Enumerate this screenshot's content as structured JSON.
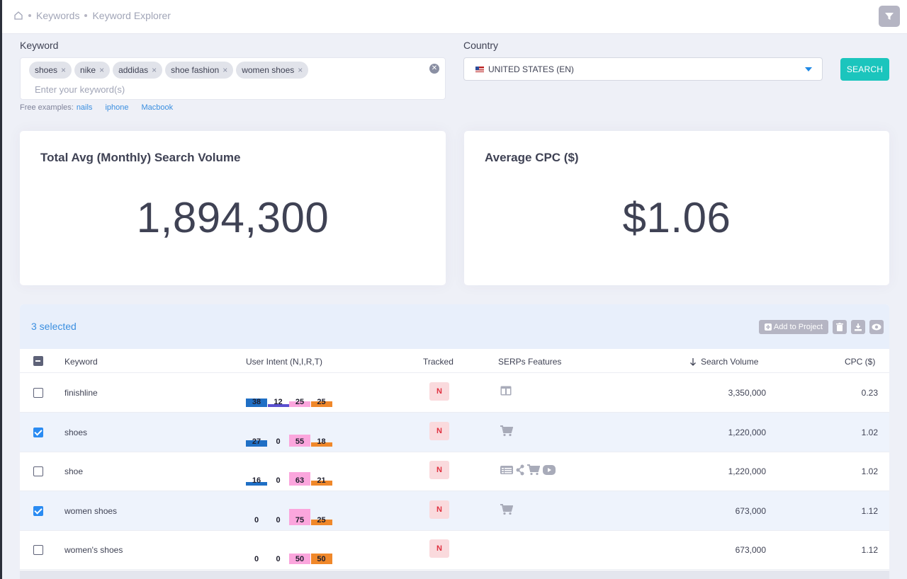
{
  "breadcrumb": {
    "items": [
      "Keywords",
      "Keyword Explorer"
    ]
  },
  "form": {
    "keyword_label": "Keyword",
    "country_label": "Country",
    "tags": [
      "shoes",
      "nike",
      "addidas",
      "shoe fashion",
      "women shoes"
    ],
    "tag_remove": "×",
    "keyword_placeholder": "Enter your keyword(s)",
    "examples_prefix": "Free examples:",
    "examples": [
      "nails",
      "iphone",
      "Macbook"
    ],
    "country_value": "UNITED STATES (EN)",
    "search_label": "SEARCH"
  },
  "stats": {
    "volume_title": "Total Avg (Monthly) Search Volume",
    "volume_value": "1,894,300",
    "cpc_title": "Average CPC ($)",
    "cpc_value": "$1.06"
  },
  "table": {
    "selected_text": "3 selected",
    "add_to_project": "Add to Project",
    "headers": {
      "keyword": "Keyword",
      "intent": "User Intent (N,I,R,T)",
      "tracked": "Tracked",
      "serps": "SERPs Features",
      "volume": "Search Volume",
      "cpc": "CPC ($)"
    },
    "rows": [
      {
        "keyword": "finishline",
        "checked": false,
        "intent": [
          38,
          12,
          25,
          25
        ],
        "tracked": "N",
        "serps": [
          "layout-icon"
        ],
        "volume": "3,350,000",
        "cpc": "0.23"
      },
      {
        "keyword": "shoes",
        "checked": true,
        "intent": [
          27,
          0,
          55,
          18
        ],
        "tracked": "N",
        "serps": [
          "cart-icon"
        ],
        "volume": "1,220,000",
        "cpc": "1.02"
      },
      {
        "keyword": "shoe",
        "checked": false,
        "intent": [
          16,
          0,
          63,
          21
        ],
        "tracked": "N",
        "serps": [
          "list-icon",
          "share-icon",
          "cart-icon",
          "video-icon"
        ],
        "volume": "1,220,000",
        "cpc": "1.02"
      },
      {
        "keyword": "women shoes",
        "checked": true,
        "intent": [
          0,
          0,
          75,
          25
        ],
        "tracked": "N",
        "serps": [
          "cart-icon"
        ],
        "volume": "673,000",
        "cpc": "1.12"
      },
      {
        "keyword": "women's shoes",
        "checked": false,
        "intent": [
          0,
          0,
          50,
          50
        ],
        "tracked": "N",
        "serps": [],
        "volume": "673,000",
        "cpc": "1.12"
      }
    ]
  },
  "colors": {
    "intent_n": "#1f6fc5",
    "intent_i": "#5a4fcf",
    "intent_r": "#fba6dd",
    "intent_t": "#f0882a",
    "search_button": "#1bc5bd",
    "link": "#3b8fe0",
    "badge_bg": "#fadadd",
    "badge_text": "#e0303f"
  }
}
